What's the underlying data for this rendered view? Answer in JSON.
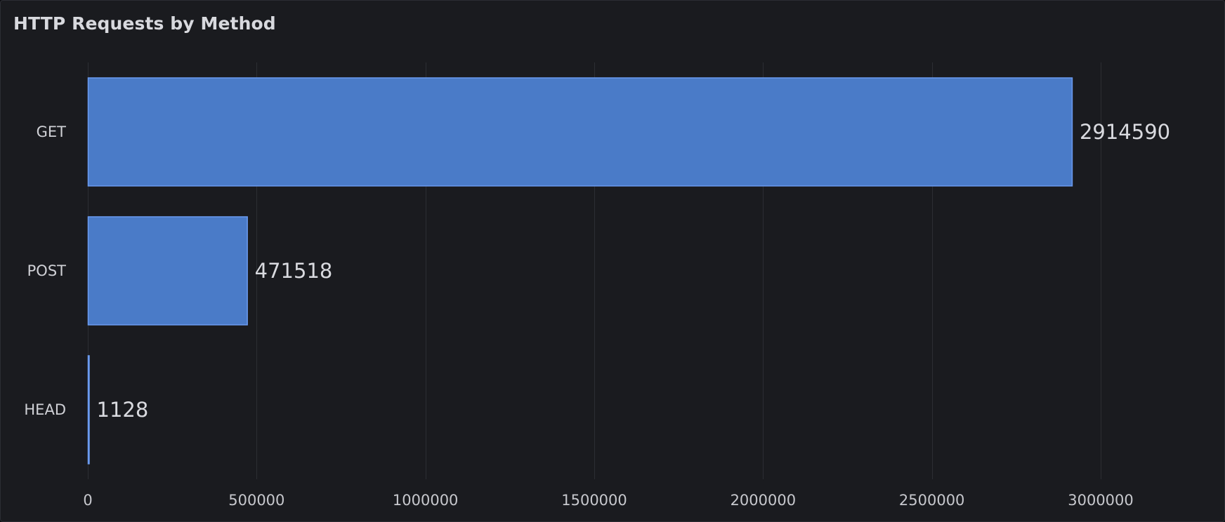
{
  "panel": {
    "title": "HTTP Requests by Method"
  },
  "colors": {
    "background": "#1a1b1f",
    "bar_fill": "#4a7bc8",
    "bar_stroke": "#6b9bf0",
    "grid": "#2c2e33"
  },
  "chart_data": {
    "type": "bar",
    "orientation": "horizontal",
    "title": "HTTP Requests by Method",
    "categories": [
      "GET",
      "POST",
      "HEAD"
    ],
    "values": [
      2914590,
      471518,
      1128
    ],
    "xlim": [
      0,
      3300000
    ],
    "x_ticks": [
      0,
      500000,
      1000000,
      1500000,
      2000000,
      2500000,
      3000000
    ],
    "x_tick_labels": [
      "0",
      "500000",
      "1000000",
      "1500000",
      "2000000",
      "2500000",
      "3000000"
    ],
    "grid": true,
    "legend": "none"
  }
}
